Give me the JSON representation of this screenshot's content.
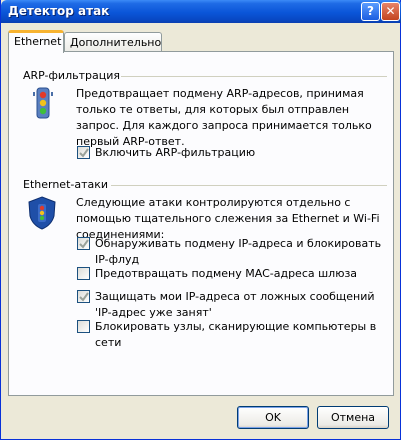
{
  "window": {
    "title": "Детектор атак",
    "help_glyph": "?",
    "close_glyph": "✕"
  },
  "tabs": [
    {
      "label": "Ethernet",
      "active": true
    },
    {
      "label": "Дополнительно",
      "active": false
    }
  ],
  "arp": {
    "title": "ARP-фильтрация",
    "icon": "traffic-light-icon",
    "description": "Предотвращает подмену ARP-адресов, принимая только те ответы, для которых был отправлен запрос. Для каждого запроса принимается только первый ARP-ответ.",
    "checkbox": {
      "label": "Включить ARP-фильтрацию",
      "checked": true
    }
  },
  "ethernet": {
    "title": "Ethernet-атаки",
    "icon": "shield-traffic-light-icon",
    "description": "Следующие атаки контролируются отдельно с помощью тщательного слежения за Ethernet и Wi-Fi соединениями:",
    "checkboxes": [
      {
        "label": "Обнаруживать подмену IP-адреса и блокировать IP-флуд",
        "checked": true
      },
      {
        "label": "Предотвращать подмену MAC-адреса шлюза",
        "checked": false
      },
      {
        "label": "Защищать мои IP-адреса от ложных сообщений 'IP-адрес уже занят'",
        "checked": true
      },
      {
        "label": "Блокировать узлы, сканирующие компьютеры в сети",
        "checked": false
      }
    ]
  },
  "buttons": {
    "ok": "OK",
    "cancel": "Отмена"
  },
  "colors": {
    "titlebar": "#0a55d8",
    "active_tab_accent": "#f7b330",
    "check_mark": "#21a121"
  }
}
